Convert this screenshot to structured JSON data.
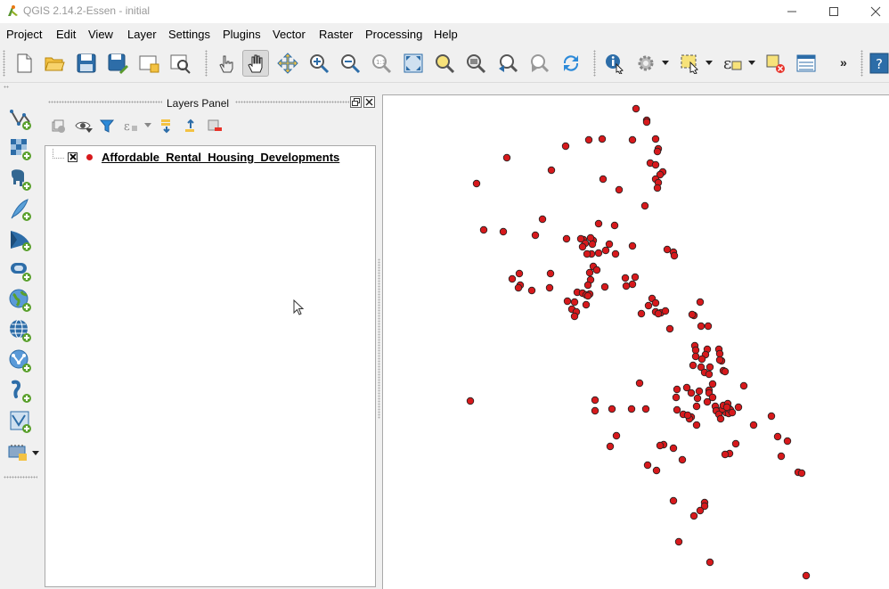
{
  "window": {
    "title": "QGIS 2.14.2-Essen - initial"
  },
  "menubar": {
    "items": [
      "Project",
      "Edit",
      "View",
      "Layer",
      "Settings",
      "Plugins",
      "Vector",
      "Raster",
      "Processing",
      "Help"
    ]
  },
  "toolbar": {
    "overflow_label": "»"
  },
  "layers_panel": {
    "title": "Layers Panel",
    "layers": [
      {
        "name": "Affordable_Rental_Housing_Developments",
        "visible": true,
        "symbol_color": "#d7191c"
      }
    ]
  },
  "map": {
    "point_color": "#d7191c",
    "point_stroke": "#222222"
  }
}
